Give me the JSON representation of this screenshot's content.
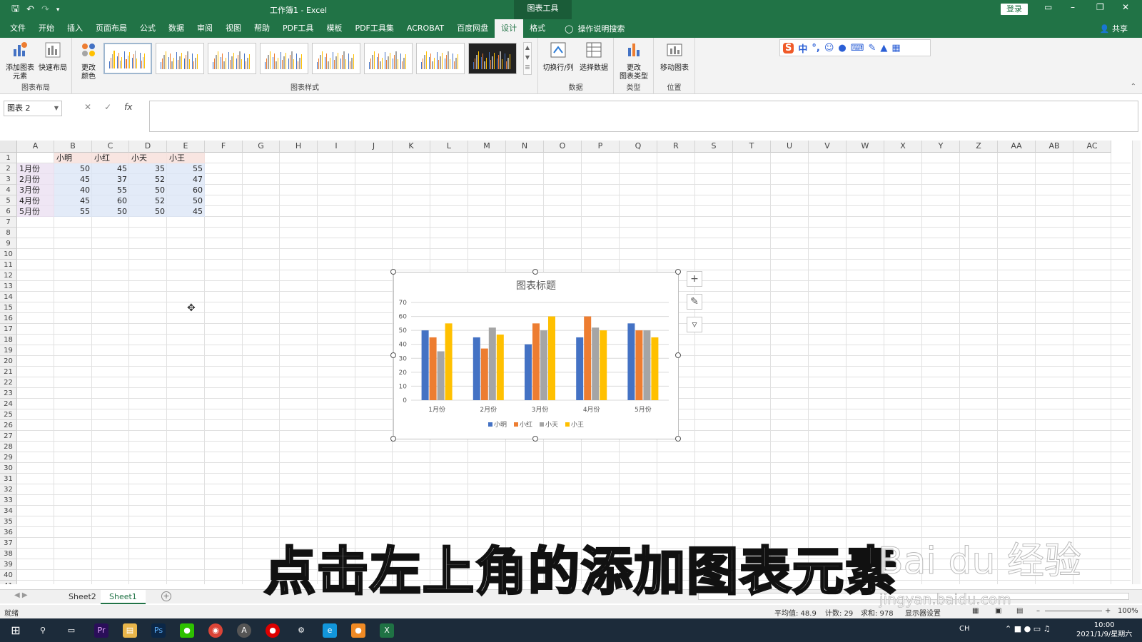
{
  "window": {
    "title": "工作簿1 - Excel",
    "context_tab": "图表工具",
    "login": "登录"
  },
  "ribbon_tabs": [
    "文件",
    "开始",
    "插入",
    "页面布局",
    "公式",
    "数据",
    "审阅",
    "视图",
    "帮助",
    "PDF工具",
    "模板",
    "PDF工具集",
    "ACROBAT",
    "百度网盘",
    "设计",
    "格式"
  ],
  "active_tab": "设计",
  "tell_me": "操作说明搜索",
  "share": "共享",
  "ribbon": {
    "add_element": "添加图表\n元素",
    "quick_layout": "快速布局",
    "change_color": "更改\n颜色",
    "group_layout": "图表布局",
    "group_styles": "图表样式",
    "switch_rowcol": "切换行/列",
    "select_data": "选择数据",
    "group_data": "数据",
    "change_type": "更改\n图表类型",
    "group_type": "类型",
    "move_chart": "移动图表",
    "group_location": "位置"
  },
  "name_box": "图表 2",
  "fx": "fx",
  "columns": [
    "A",
    "B",
    "C",
    "D",
    "E",
    "F",
    "G",
    "H",
    "I",
    "J",
    "K",
    "L",
    "M",
    "N",
    "O",
    "P",
    "Q",
    "R",
    "S",
    "T",
    "U",
    "V",
    "W",
    "X",
    "Y",
    "Z",
    "AA",
    "AB",
    "AC"
  ],
  "table": {
    "headers": [
      "",
      "小明",
      "小红",
      "小天",
      "小王"
    ],
    "rows": [
      {
        "label": "1月份",
        "values": [
          "50",
          "45",
          "35",
          "55"
        ]
      },
      {
        "label": "2月份",
        "values": [
          "45",
          "37",
          "52",
          "47"
        ]
      },
      {
        "label": "3月份",
        "values": [
          "40",
          "55",
          "50",
          "60"
        ]
      },
      {
        "label": "4月份",
        "values": [
          "45",
          "60",
          "52",
          "50"
        ]
      },
      {
        "label": "5月份",
        "values": [
          "55",
          "50",
          "50",
          "45"
        ]
      }
    ]
  },
  "chart_data": {
    "type": "bar",
    "title": "图表标题",
    "categories": [
      "1月份",
      "2月份",
      "3月份",
      "4月份",
      "5月份"
    ],
    "series": [
      {
        "name": "小明",
        "color": "#4472C4",
        "values": [
          50,
          45,
          40,
          45,
          55
        ]
      },
      {
        "name": "小红",
        "color": "#ED7D31",
        "values": [
          45,
          37,
          55,
          60,
          50
        ]
      },
      {
        "name": "小天",
        "color": "#A5A5A5",
        "values": [
          35,
          52,
          50,
          52,
          50
        ]
      },
      {
        "name": "小王",
        "color": "#FFC000",
        "values": [
          55,
          47,
          60,
          50,
          45
        ]
      }
    ],
    "ylim": [
      0,
      70
    ],
    "yticks": [
      0,
      10,
      20,
      30,
      40,
      50,
      60,
      70
    ],
    "grid": true,
    "legend": "bottom"
  },
  "sheets": [
    "Sheet2",
    "Sheet1"
  ],
  "active_sheet": "Sheet1",
  "status": {
    "ready": "就绪",
    "average": "平均值: 48.9",
    "count": "计数: 29",
    "sum": "求和: 978",
    "display_settings": "显示器设置",
    "zoom": "100%"
  },
  "subtitle": "点击左上角的添加图表元素",
  "watermark": "Bai du 经验",
  "watermark_url": "jingyan.baidu.com",
  "taskbar": {
    "ime": "CH",
    "time": "10:00",
    "date": "2021/1/9/星期六"
  },
  "colors": {
    "excel_green": "#217346",
    "taskbar": "#1c2b3a"
  }
}
